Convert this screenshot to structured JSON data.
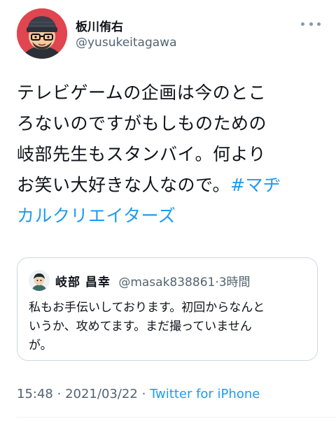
{
  "author": {
    "display_name": "板川侑右",
    "handle": "@yusukeitagawa"
  },
  "tweet": {
    "lines": [
      "テレビゲームの企画は今のとこ",
      "ろないのですがもしものための",
      "岐部先生もスタンバイ。何より",
      "お笑い大好きな人なので。"
    ],
    "hashtag_part1": "#マヂ",
    "hashtag_part2": "カルクリエイターズ"
  },
  "quoted_tweet": {
    "display_name": "岐部 昌幸",
    "handle": "@masak838861",
    "separator": "·",
    "time": "3時間",
    "lines": [
      "私もお手伝いしております。初回からなんと",
      "いうか、攻めてます。まだ撮っていません",
      "が。"
    ]
  },
  "meta": {
    "time": "15:48",
    "date": "2021/03/22",
    "source": "Twitter for iPhone",
    "separator": "·"
  },
  "colors": {
    "link": "#1d9bf0",
    "secondary_text": "#536471",
    "border": "#cfd9de",
    "avatar_bg": "#e04550"
  }
}
